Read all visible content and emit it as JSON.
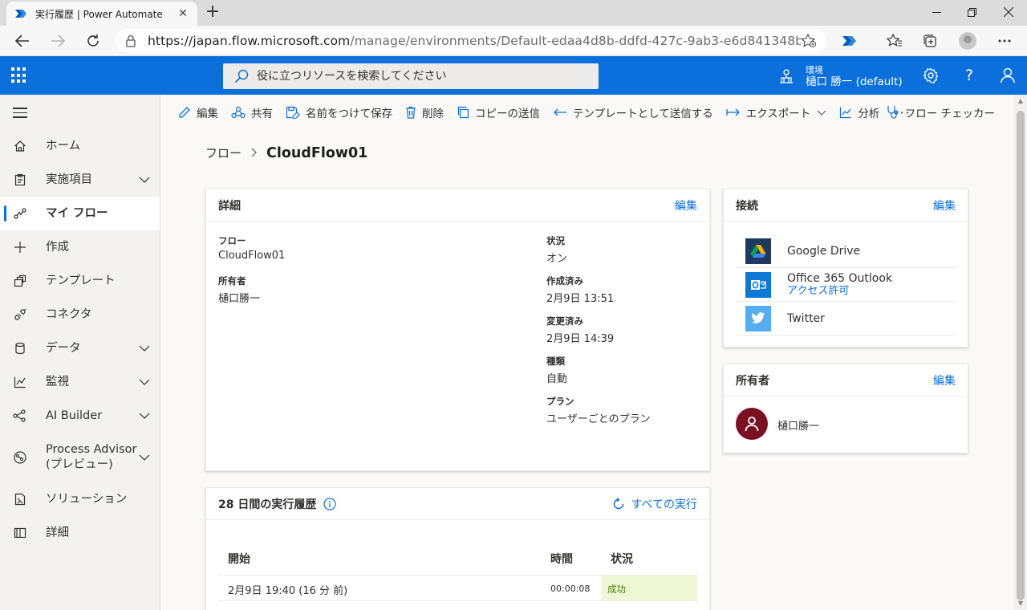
{
  "browser": {
    "tab_title": "実行履歴 | Power Automate",
    "url_host": "https://japan.flow.microsoft.com",
    "url_path": "/manage/environments/Default-edaa4d8b-ddfd-427c-9ab3-e6d841348b94/flo..."
  },
  "header": {
    "search_placeholder": "役に立つリソースを検索してください",
    "env_label": "環境",
    "env_name": "樋口 勝一 (default)",
    "help_label": "?"
  },
  "nav": {
    "items": [
      {
        "label": "ホーム"
      },
      {
        "label": "実施項目"
      },
      {
        "label": "マイ フロー"
      },
      {
        "label": "作成"
      },
      {
        "label": "テンプレート"
      },
      {
        "label": "コネクタ"
      },
      {
        "label": "データ"
      },
      {
        "label": "監視"
      },
      {
        "label": "AI Builder"
      },
      {
        "label": "Process Advisor\n(プレビュー)"
      },
      {
        "label": "ソリューション"
      },
      {
        "label": "詳細"
      }
    ]
  },
  "commands": {
    "edit": "編集",
    "share": "共有",
    "save_as": "名前をつけて保存",
    "delete": "削除",
    "send_copy": "コピーの送信",
    "send_template": "テンプレートとして送信する",
    "export": "エクスポート",
    "analytics": "分析",
    "more": "···",
    "checker": "フロー チェッカー"
  },
  "breadcrumb": {
    "parent": "フロー",
    "current": "CloudFlow01"
  },
  "details": {
    "title": "詳細",
    "edit_link": "編集",
    "flow_label": "フロー",
    "flow_value": "CloudFlow01",
    "owner_label": "所有者",
    "owner_value": "樋口勝一",
    "status_label": "状況",
    "status_value": "オン",
    "created_label": "作成済み",
    "created_value": "2月9日 13:51",
    "modified_label": "変更済み",
    "modified_value": "2月9日 14:39",
    "type_label": "種類",
    "type_value": "自動",
    "plan_label": "プラン",
    "plan_value": "ユーザーごとのプラン"
  },
  "connections": {
    "title": "接続",
    "edit_link": "編集",
    "items": [
      {
        "name": "Google Drive",
        "access": ""
      },
      {
        "name": "Office 365 Outlook",
        "access": "アクセス許可"
      },
      {
        "name": "Twitter",
        "access": ""
      }
    ]
  },
  "owners": {
    "title": "所有者",
    "edit_link": "編集",
    "owner_name": "樋口勝一"
  },
  "runs": {
    "title": "28 日間の実行履歴",
    "all_runs_link": "すべての実行",
    "col_start": "開始",
    "col_duration": "時間",
    "col_status": "状況",
    "rows": [
      {
        "start": "2月9日 19:40 (16 分 前)",
        "duration": "00:00:08",
        "status": "成功"
      }
    ]
  },
  "colors": {
    "brand": "#0b6fdc",
    "owner_avatar": "#7a1022",
    "success_bg": "#eff6d6"
  }
}
